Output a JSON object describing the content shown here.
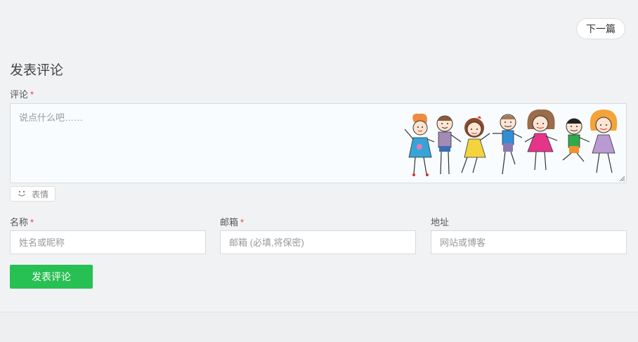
{
  "nav": {
    "next_label": "下一篇"
  },
  "comment_form": {
    "title": "发表评论",
    "comment_label": "评论",
    "required_mark": "*",
    "comment_placeholder": "说点什么吧……",
    "emoji_label": "表情",
    "name_label": "名称",
    "name_placeholder": "姓名或昵称",
    "email_label": "邮箱",
    "email_placeholder": "邮箱 (必填,将保密)",
    "url_label": "地址",
    "url_placeholder": "网站或博客",
    "submit_label": "发表评论"
  },
  "colors": {
    "accent_green": "#27c052",
    "required_red": "#e0443b"
  },
  "icons": {
    "emoji": "smile-icon",
    "decoration": "kids-illustration"
  }
}
